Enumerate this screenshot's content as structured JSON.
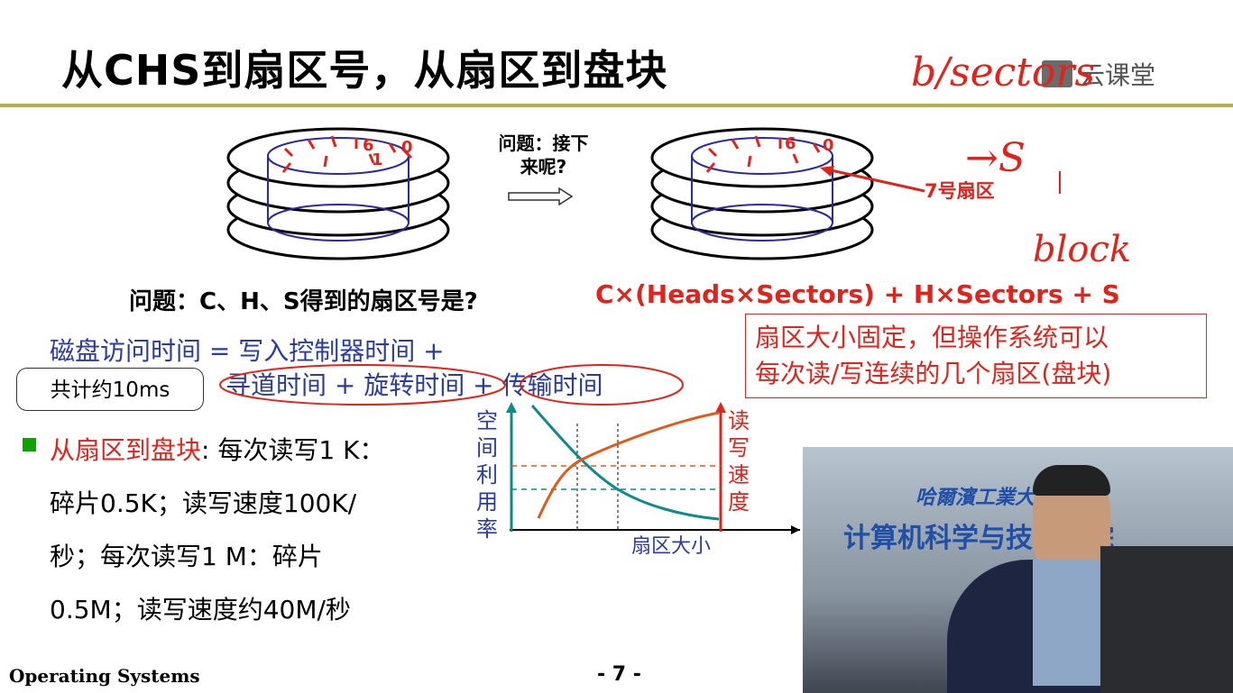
{
  "slide": {
    "title": "从CHS到扇区号，从扇区到盘块",
    "logo_text": "云课堂",
    "question_next_line1": "问题：接下",
    "question_next_line2": "来呢?",
    "sector_label": "7号扇区",
    "disk_left_numbers": [
      "6",
      "0",
      "1"
    ],
    "disk_right_numbers": [
      "6",
      "0"
    ],
    "question": "问题：C、H、S得到的扇区号是?",
    "formula": "C×(Heads×Sectors) + H×Sectors + S",
    "note_line1": "扇区大小固定，但操作系统可以",
    "note_line2": "每次读/写连续的几个扇区(盘块)",
    "access_line1": "磁盘访问时间 = 写入控制器时间 +",
    "access_line2": "寻道时间 + 旋转时间 + 传输时间",
    "total_box": "共计约10ms",
    "bullet_head": "从扇区到盘块",
    "bullet_lines": [
      ": 每次读写1 K：",
      "碎片0.5K；读写速度100K/",
      "秒；每次读写1 M：碎片",
      "0.5M；读写速度约40M/秒"
    ],
    "footer_left": "Operating Systems",
    "footer_page": "- 7 -"
  },
  "chart_data": {
    "type": "line",
    "xlabel": "扇区大小",
    "ylabel_left": "空间利用率",
    "ylabel_right": "读写速度",
    "series": [
      {
        "name": "空间利用率",
        "color": "#0e8a8a",
        "trend": "decreasing"
      },
      {
        "name": "读写速度",
        "color": "#e05a1a",
        "trend": "increasing"
      }
    ]
  },
  "video": {
    "banner_line1": "哈爾濱工業大",
    "banner_line2": "计算机科学与技术学院"
  },
  "handwriting": {
    "top_right_1": "b/sectors",
    "top_right_2": "→S",
    "top_right_3": "block"
  },
  "colors": {
    "accent_red": "#e0231b",
    "text_blue": "#2a3c9e",
    "title_rule": "#b7b04a"
  }
}
